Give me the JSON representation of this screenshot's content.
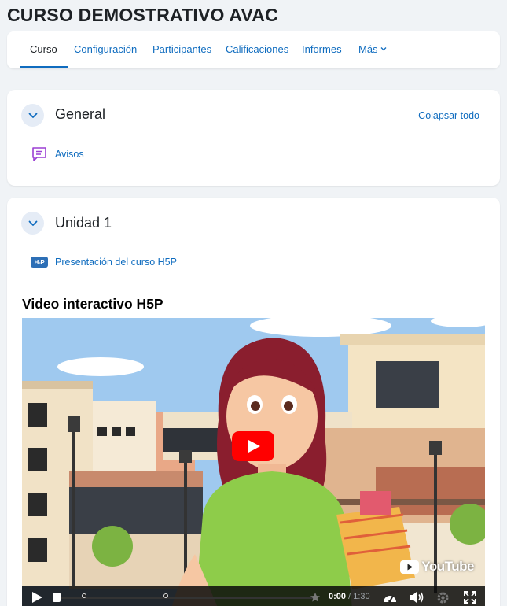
{
  "course": {
    "title": "CURSO DEMOSTRATIVO AVAC"
  },
  "nav": {
    "tabs": [
      {
        "label": "Curso",
        "active": true
      },
      {
        "label": "Configuración",
        "active": false
      },
      {
        "label": "Participantes",
        "active": false
      },
      {
        "label": "Calificaciones",
        "active": false
      },
      {
        "label": "Informes",
        "active": false
      },
      {
        "label": "Más",
        "active": false
      }
    ]
  },
  "sections": {
    "general": {
      "name": "General",
      "collapse_all": "Colapsar todo",
      "activities": [
        {
          "label": "Avisos",
          "icon": "forum-icon"
        }
      ]
    },
    "unidad1": {
      "name": "Unidad 1",
      "activities": [
        {
          "label": "Presentación del curso H5P",
          "icon": "h5p-icon",
          "badge": "H-P"
        }
      ],
      "h5p_title": "Video interactivo H5P",
      "video": {
        "brand": "YouTube",
        "current_time": "0:00",
        "separator": "/",
        "duration": "1:30",
        "progress": 0
      }
    }
  },
  "colors": {
    "accent": "#0f6cbf",
    "background": "#f0f3f6",
    "youtube_red": "#ff0000",
    "h5p_blue": "#2d6fb6"
  }
}
